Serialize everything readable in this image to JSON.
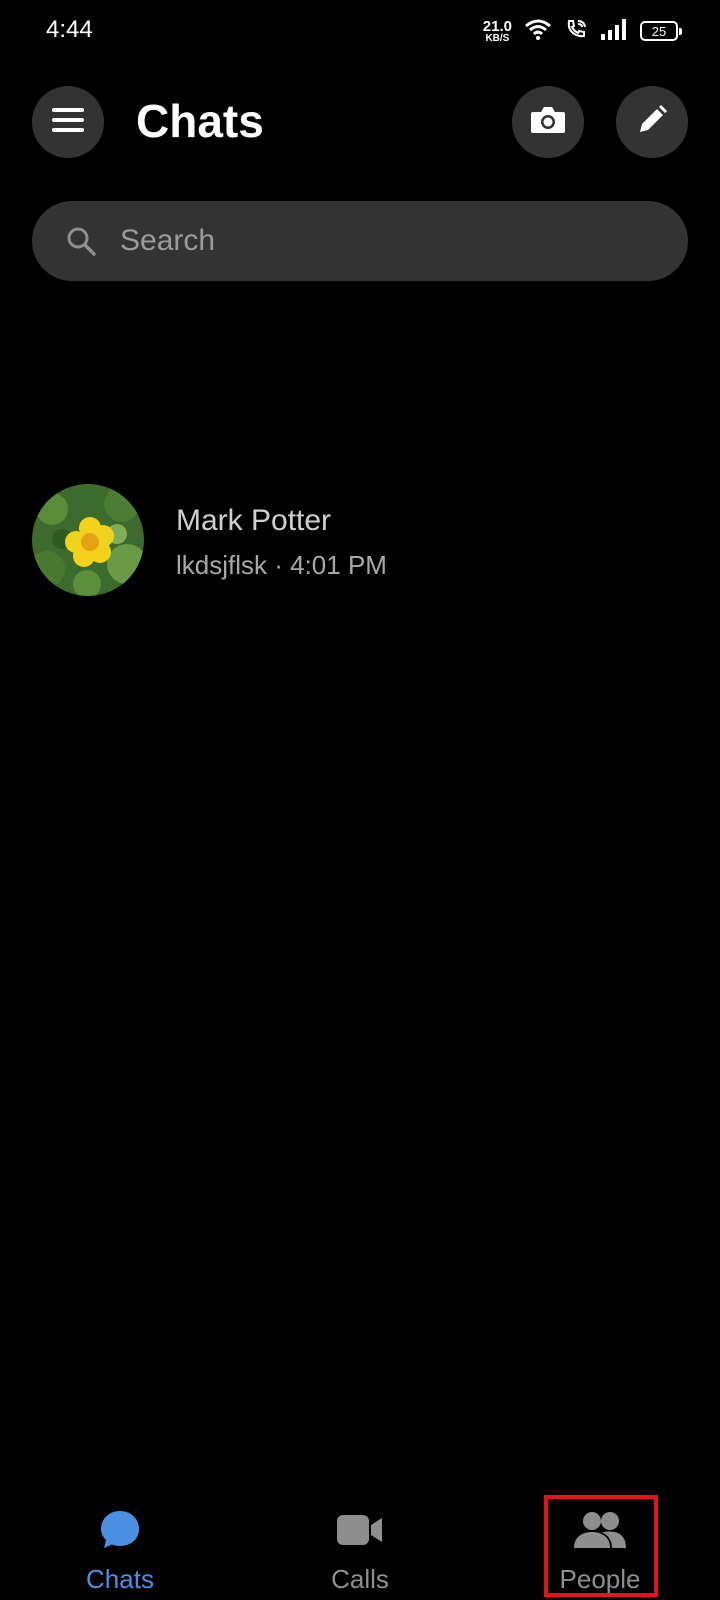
{
  "status_bar": {
    "time": "4:44",
    "net_speed_value": "21.0",
    "net_speed_unit": "KB/S",
    "battery": "25"
  },
  "header": {
    "title": "Chats"
  },
  "search": {
    "placeholder": "Search"
  },
  "chats": [
    {
      "name": "Mark Potter",
      "preview": "lkdsjflsk · 4:01 PM"
    }
  ],
  "bottom_nav": {
    "items": [
      {
        "label": "Chats",
        "active": true
      },
      {
        "label": "Calls",
        "active": false
      },
      {
        "label": "People",
        "active": false
      }
    ]
  },
  "colors": {
    "background": "#000000",
    "surface": "#333333",
    "accent": "#4a90e2",
    "inactive": "#8e8e8e",
    "highlight": "#e0161b"
  }
}
